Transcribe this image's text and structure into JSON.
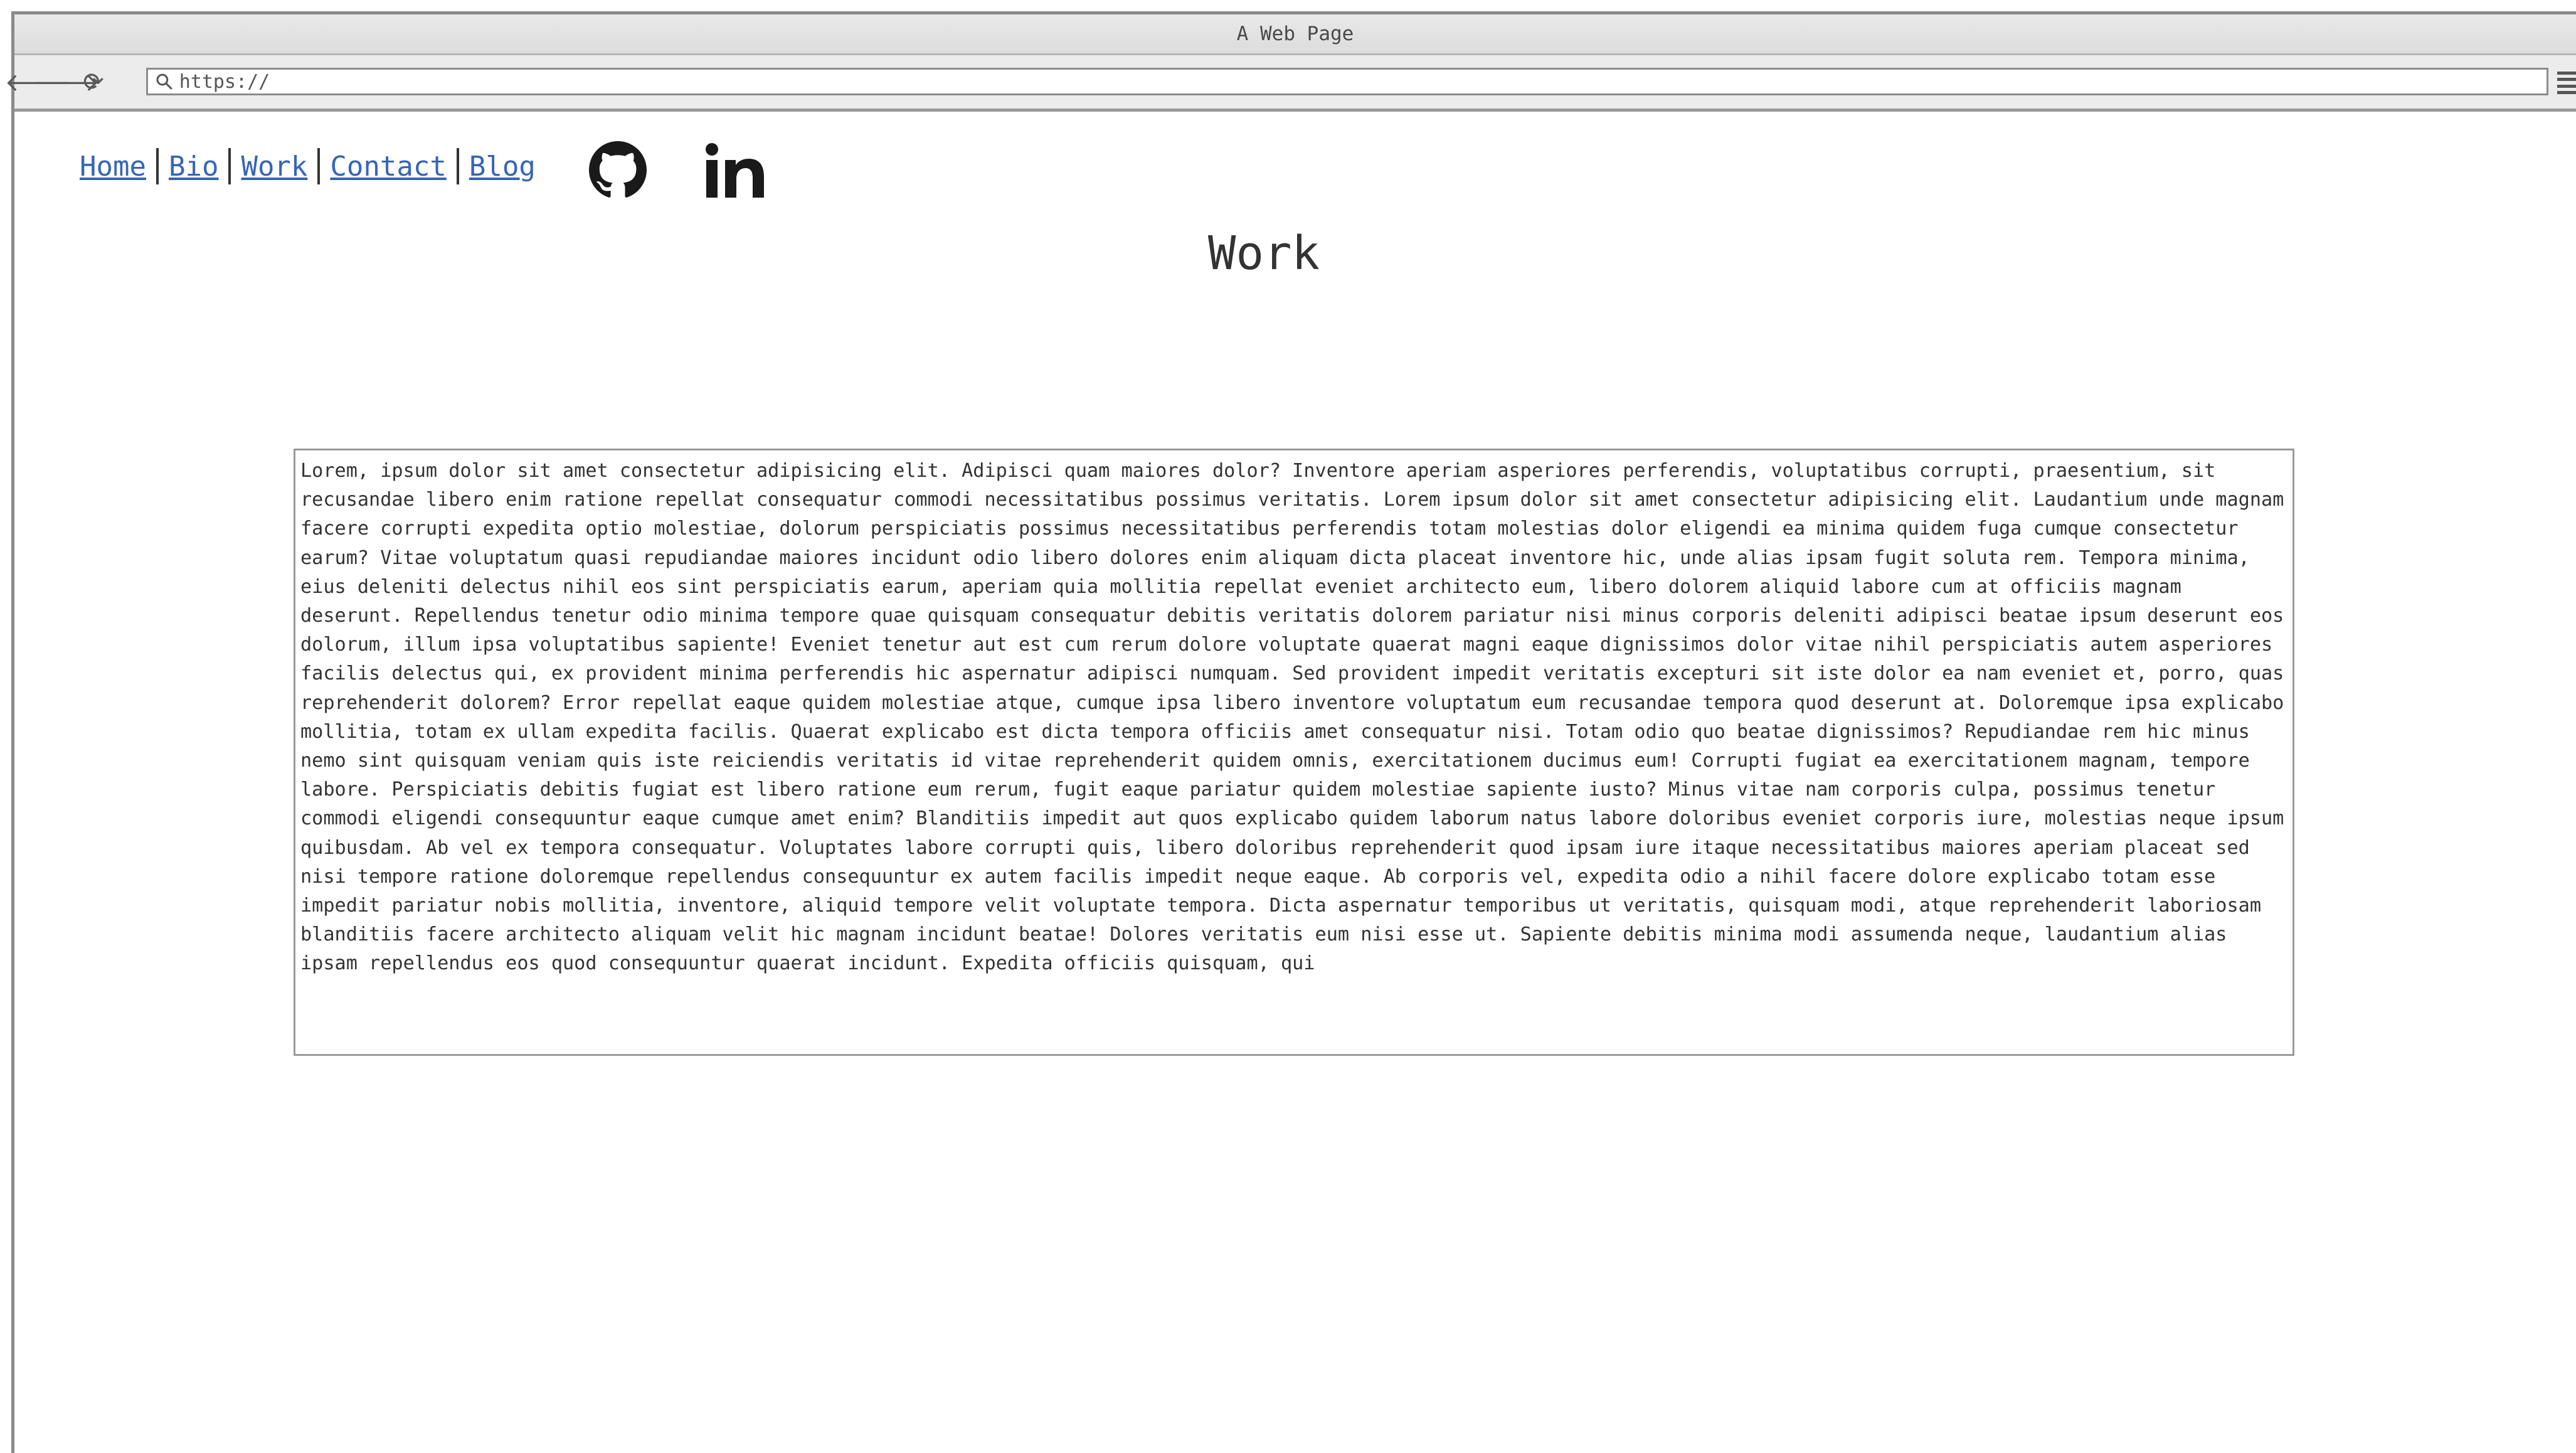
{
  "window": {
    "title": "A Web Page"
  },
  "toolbar": {
    "back_icon": "arrow-left-icon",
    "forward_icon": "arrow-right-icon",
    "reload_icon": "reload-icon",
    "address_value": "https://",
    "menu_icon": "hamburger-menu-icon"
  },
  "nav": {
    "links": [
      "Home",
      "Bio",
      "Work",
      "Contact",
      "Blog"
    ],
    "link_color": "#3565b8"
  },
  "social": {
    "github_icon": "github-icon",
    "linkedin_label": "in"
  },
  "page": {
    "title": "Work",
    "body_text": "Lorem, ipsum dolor sit amet consectetur adipisicing elit. Adipisci quam maiores dolor? Inventore aperiam asperiores perferendis, voluptatibus corrupti, praesentium, sit recusandae libero enim ratione repellat consequatur commodi necessitatibus possimus veritatis. Lorem ipsum dolor sit amet consectetur adipisicing elit. Laudantium unde magnam facere corrupti expedita optio molestiae, dolorum perspiciatis possimus necessitatibus perferendis totam molestias dolor eligendi ea minima quidem fuga cumque consectetur earum? Vitae voluptatum quasi repudiandae maiores incidunt odio libero dolores enim aliquam dicta placeat inventore hic, unde alias ipsam fugit soluta rem. Tempora minima, eius deleniti delectus nihil eos sint perspiciatis earum, aperiam quia mollitia repellat eveniet architecto eum, libero dolorem aliquid labore cum at officiis magnam deserunt. Repellendus tenetur odio minima tempore quae quisquam consequatur debitis veritatis dolorem pariatur nisi minus corporis deleniti adipisci beatae ipsum deserunt eos dolorum, illum ipsa voluptatibus sapiente! Eveniet tenetur aut est cum rerum dolore voluptate quaerat magni eaque dignissimos dolor vitae nihil perspiciatis autem asperiores facilis delectus qui, ex provident minima perferendis hic aspernatur adipisci numquam. Sed provident impedit veritatis excepturi sit iste dolor ea nam eveniet et, porro, quas reprehenderit dolorem? Error repellat eaque quidem molestiae atque, cumque ipsa libero inventore voluptatum eum recusandae tempora quod deserunt at. Doloremque ipsa explicabo mollitia, totam ex ullam expedita facilis. Quaerat explicabo est dicta tempora officiis amet consequatur nisi. Totam odio quo beatae dignissimos? Repudiandae rem hic minus nemo sint quisquam veniam quis iste reiciendis veritatis id vitae reprehenderit quidem omnis, exercitationem ducimus eum! Corrupti fugiat ea exercitationem magnam, tempore labore. Perspiciatis debitis fugiat est libero ratione eum rerum, fugit eaque pariatur quidem molestiae sapiente iusto? Minus vitae nam corporis culpa, possimus tenetur commodi eligendi consequuntur eaque cumque amet enim? Blanditiis impedit aut quos explicabo quidem laborum natus labore doloribus eveniet corporis iure, molestias neque ipsum quibusdam. Ab vel ex tempora consequatur. Voluptates labore corrupti quis, libero doloribus reprehenderit quod ipsam iure itaque necessitatibus maiores aperiam placeat sed nisi tempore ratione doloremque repellendus consequuntur ex autem facilis impedit neque eaque. Ab corporis vel, expedita odio a nihil facere dolore explicabo totam esse impedit pariatur nobis mollitia, inventore, aliquid tempore velit voluptate tempora. Dicta aspernatur temporibus ut veritatis, quisquam modi, atque reprehenderit laboriosam blanditiis facere architecto aliquam velit hic magnam incidunt beatae! Dolores veritatis eum nisi esse ut. Sapiente debitis minima modi assumenda neque, laudantium alias ipsam repellendus eos quod consequuntur quaerat incidunt. Expedita officiis quisquam, qui"
  }
}
